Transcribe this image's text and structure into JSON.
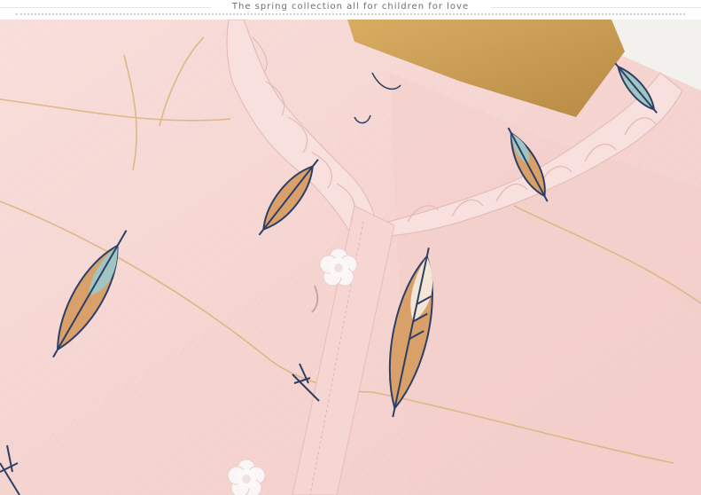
{
  "header": {
    "caption": "The spring collection all for children for love"
  },
  "photo": {
    "subject": "pink-feather-print-blouse-closeup",
    "colors": {
      "fabric": "#f6d9d6",
      "fabric_shadow": "#e9c2bd",
      "hanger": "#c99a4f",
      "feather_blue": "#2e3f66",
      "feather_orange": "#d9a06a",
      "feather_teal": "#9fc6c2",
      "gold_line": "#d9b27a",
      "button": "#fbf5f5"
    }
  }
}
